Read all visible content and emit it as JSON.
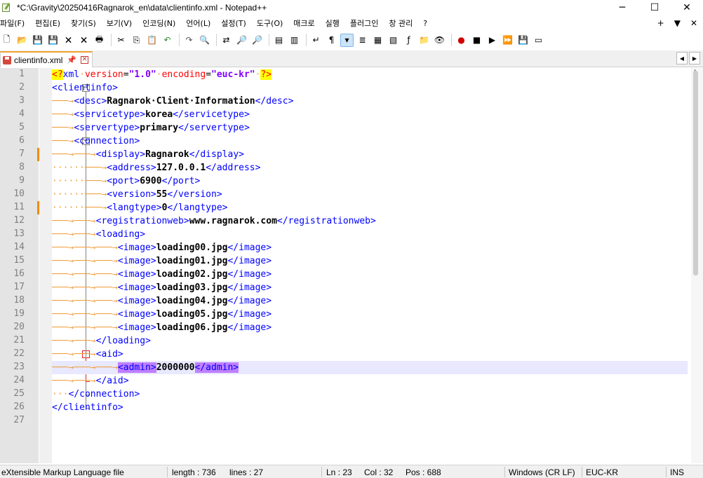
{
  "window": {
    "title": "*C:\\Gravity\\20250416Ragnarok_en\\data\\clientinfo.xml - Notepad++",
    "minimize": "─",
    "maximize": "☐",
    "close": "✕"
  },
  "menu": {
    "items": [
      "파일(F)",
      "편집(E)",
      "찾기(S)",
      "보기(V)",
      "인코딩(N)",
      "언어(L)",
      "설정(T)",
      "도구(O)",
      "매크로",
      "실행",
      "플러그인",
      "창 관리",
      "?"
    ],
    "right": [
      "+",
      "▼",
      "✕"
    ]
  },
  "toolbar": {
    "icons": [
      "new-file-icon",
      "open-file-icon",
      "save-icon",
      "save-all-icon",
      "close-icon",
      "close-all-icon",
      "print-icon",
      "cut-icon",
      "copy-icon",
      "paste-icon",
      "undo-icon",
      "redo-icon",
      "find-icon",
      "replace-icon",
      "zoom-in-icon",
      "zoom-out-icon",
      "sync-vertical-icon",
      "sync-horizontal-icon",
      "word-wrap-icon",
      "show-all-chars-icon",
      "indent-guide-icon",
      "user-lang-icon",
      "doc-map-icon",
      "doc-list-icon",
      "function-list-icon",
      "folder-workspace-icon",
      "monitoring-icon",
      "record-macro-icon",
      "stop-record-icon",
      "play-macro-icon",
      "run-macro-multiple-icon",
      "save-macro-icon",
      "launch-icon"
    ],
    "glyphs": [
      "🗋",
      "📂",
      "💾",
      "💾",
      "🗙",
      "🗙",
      "🖶",
      "✂",
      "⎘",
      "📋",
      "↶",
      "↷",
      "🔍",
      "⇄",
      "🔎",
      "🔎",
      "▤",
      "▥",
      "↵",
      "¶",
      "▾",
      "≣",
      "▦",
      "▧",
      "ƒ",
      "📁",
      "👁",
      "●",
      "■",
      "▶",
      "⏩",
      "💾",
      "▭"
    ]
  },
  "tab": {
    "label": "clientinfo.xml",
    "pin": "📌",
    "close": "✕",
    "scroll_left": "◀",
    "scroll_right": "▶"
  },
  "editor": {
    "line_numbers": [
      "1",
      "2",
      "3",
      "4",
      "5",
      "6",
      "7",
      "8",
      "9",
      "10",
      "11",
      "12",
      "13",
      "14",
      "15",
      "16",
      "17",
      "18",
      "19",
      "20",
      "21",
      "22",
      "23",
      "24",
      "25",
      "26",
      "27"
    ],
    "current_line": 23,
    "lines": [
      [
        [
          "pi",
          "<?"
        ],
        [
          "tag",
          "xml"
        ],
        [
          "ws",
          "·"
        ],
        [
          "attr",
          "version"
        ],
        [
          "eq",
          "="
        ],
        [
          "val",
          "\"1.0\""
        ],
        [
          "ws",
          "·"
        ],
        [
          "attr",
          "encoding"
        ],
        [
          "eq",
          "="
        ],
        [
          "val",
          "\"euc-kr\""
        ],
        [
          "ws",
          "·"
        ],
        [
          "pi",
          "?>"
        ]
      ],
      [
        [
          "tag",
          "<clientinfo>"
        ]
      ],
      [
        [
          "ind",
          "───→"
        ],
        [
          "tag",
          "<desc>"
        ],
        [
          "txt",
          "Ragnarok·Client·Information"
        ],
        [
          "tag",
          "</desc>"
        ]
      ],
      [
        [
          "ind",
          "───→"
        ],
        [
          "tag",
          "<servicetype>"
        ],
        [
          "txt",
          "korea"
        ],
        [
          "tag",
          "</servicetype>"
        ]
      ],
      [
        [
          "ind",
          "───→"
        ],
        [
          "tag",
          "<servertype>"
        ],
        [
          "txt",
          "primary"
        ],
        [
          "tag",
          "</servertype>"
        ]
      ],
      [
        [
          "ind",
          "───→"
        ],
        [
          "tag",
          "<connection>"
        ]
      ],
      [
        [
          "ind",
          "───→───→"
        ],
        [
          "tag",
          "<display>"
        ],
        [
          "txt",
          "Ragnarok"
        ],
        [
          "tag",
          "</display>"
        ]
      ],
      [
        [
          "ind",
          "······───→"
        ],
        [
          "tag",
          "<address>"
        ],
        [
          "txt",
          "127.0.0.1"
        ],
        [
          "tag",
          "</address>"
        ]
      ],
      [
        [
          "ind",
          "······───→"
        ],
        [
          "tag",
          "<port>"
        ],
        [
          "txt",
          "6900"
        ],
        [
          "tag",
          "</port>"
        ]
      ],
      [
        [
          "ind",
          "······───→"
        ],
        [
          "tag",
          "<version>"
        ],
        [
          "txt",
          "55"
        ],
        [
          "tag",
          "</version>"
        ]
      ],
      [
        [
          "ind",
          "······───→"
        ],
        [
          "tag",
          "<langtype>"
        ],
        [
          "txt",
          "0"
        ],
        [
          "tag",
          "</langtype>"
        ]
      ],
      [
        [
          "ind",
          "───→───→"
        ],
        [
          "tag",
          "<registrationweb>"
        ],
        [
          "txt",
          "www.ragnarok.com"
        ],
        [
          "tag",
          "</registrationweb>"
        ]
      ],
      [
        [
          "ind",
          "───→───→"
        ],
        [
          "tag",
          "<loading>"
        ]
      ],
      [
        [
          "ind",
          "───→───→───→"
        ],
        [
          "tag",
          "<image>"
        ],
        [
          "txt",
          "loading00.jpg"
        ],
        [
          "tag",
          "</image>"
        ]
      ],
      [
        [
          "ind",
          "───→───→───→"
        ],
        [
          "tag",
          "<image>"
        ],
        [
          "txt",
          "loading01.jpg"
        ],
        [
          "tag",
          "</image>"
        ]
      ],
      [
        [
          "ind",
          "───→───→───→"
        ],
        [
          "tag",
          "<image>"
        ],
        [
          "txt",
          "loading02.jpg"
        ],
        [
          "tag",
          "</image>"
        ]
      ],
      [
        [
          "ind",
          "───→───→───→"
        ],
        [
          "tag",
          "<image>"
        ],
        [
          "txt",
          "loading03.jpg"
        ],
        [
          "tag",
          "</image>"
        ]
      ],
      [
        [
          "ind",
          "───→───→───→"
        ],
        [
          "tag",
          "<image>"
        ],
        [
          "txt",
          "loading04.jpg"
        ],
        [
          "tag",
          "</image>"
        ]
      ],
      [
        [
          "ind",
          "───→───→───→"
        ],
        [
          "tag",
          "<image>"
        ],
        [
          "txt",
          "loading05.jpg"
        ],
        [
          "tag",
          "</image>"
        ]
      ],
      [
        [
          "ind",
          "───→───→───→"
        ],
        [
          "tag",
          "<image>"
        ],
        [
          "txt",
          "loading06.jpg"
        ],
        [
          "tag",
          "</image>"
        ]
      ],
      [
        [
          "ind",
          "───→───→"
        ],
        [
          "tag",
          "</loading>"
        ]
      ],
      [
        [
          "ind",
          "───→───→"
        ],
        [
          "tag",
          "<aid>"
        ]
      ],
      [
        [
          "ind",
          "───→───→───→"
        ],
        [
          "hl",
          "<admin>"
        ],
        [
          "txt",
          "2000000"
        ],
        [
          "hl",
          "</adm"
        ],
        [
          "caret",
          ""
        ],
        [
          "hl",
          "in>"
        ]
      ],
      [
        [
          "ind",
          "───→───→"
        ],
        [
          "tag",
          "</aid>"
        ]
      ],
      [
        [
          "ind",
          "···"
        ],
        [
          "tag",
          "</connection>"
        ]
      ],
      [
        [
          "tag",
          "</clientinfo>"
        ]
      ],
      []
    ],
    "changed_lines": [
      7,
      11
    ]
  },
  "status": {
    "file_type": "eXtensible Markup Language file",
    "length": "length : 736",
    "lines": "lines : 27",
    "ln": "Ln : 23",
    "col": "Col : 32",
    "pos": "Pos : 688",
    "eol": "Windows (CR LF)",
    "encoding": "EUC-KR",
    "mode": "INS"
  },
  "colors": {
    "tag": "#0000ff",
    "attribute": "#ff0000",
    "value": "#8000ff",
    "text": "#000000",
    "indent_guide": "#f0a040",
    "current_line": "#e8e8ff",
    "tag_match_highlight": "#c080ff",
    "changed_marker": "#f08c00"
  }
}
